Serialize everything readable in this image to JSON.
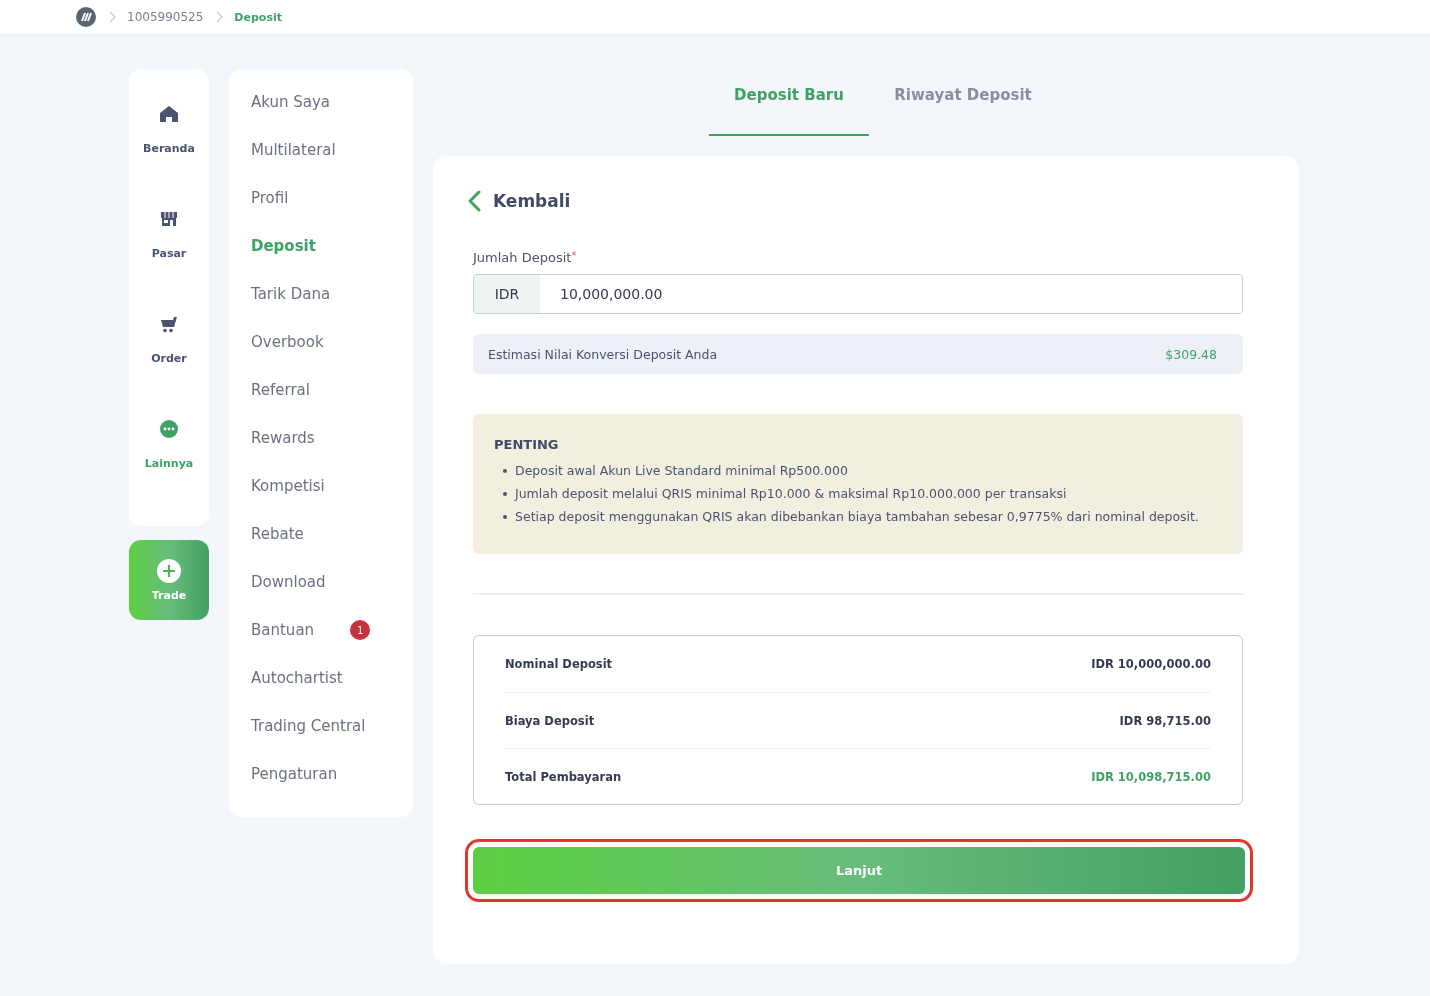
{
  "breadcrumb": [
    {
      "label": "1005990525",
      "selected": false
    },
    {
      "label": "Deposit",
      "selected": true
    }
  ],
  "rail": [
    {
      "label": "Beranda",
      "kind": "home",
      "selected": false
    },
    {
      "label": "Pasar",
      "kind": "market",
      "selected": false
    },
    {
      "label": "Order",
      "kind": "order",
      "selected": false
    },
    {
      "label": "Lainnya",
      "kind": "more",
      "selected": true
    }
  ],
  "trade_button": {
    "label": "Trade"
  },
  "menu": [
    {
      "label": "Akun Saya",
      "selected": false
    },
    {
      "label": "Multilateral",
      "selected": false
    },
    {
      "label": "Profil",
      "selected": false
    },
    {
      "label": "Deposit",
      "selected": true
    },
    {
      "label": "Tarik Dana",
      "selected": false
    },
    {
      "label": "Overbook",
      "selected": false
    },
    {
      "label": "Referral",
      "selected": false
    },
    {
      "label": "Rewards",
      "selected": false
    },
    {
      "label": "Kompetisi",
      "selected": false
    },
    {
      "label": "Rebate",
      "selected": false
    },
    {
      "label": "Download",
      "selected": false
    },
    {
      "label": "Bantuan",
      "selected": false,
      "badge": "1"
    },
    {
      "label": "Autochartist",
      "selected": false
    },
    {
      "label": "Trading Central",
      "selected": false
    },
    {
      "label": "Pengaturan",
      "selected": false
    }
  ],
  "tabs": [
    {
      "label": "Deposit Baru",
      "selected": true
    },
    {
      "label": "Riwayat Deposit",
      "selected": false
    }
  ],
  "back_link": {
    "label": "Kembali"
  },
  "amount_field": {
    "label": "Jumlah Deposit",
    "required_mark": "*",
    "currency": "IDR",
    "value": "10,000,000.00"
  },
  "estimate": {
    "label": "Estimasi Nilai Konversi Deposit Anda",
    "value": "$309.48"
  },
  "notice": {
    "title": "PENTING",
    "items": [
      "Deposit awal Akun Live Standard minimal Rp500.000",
      "Jumlah deposit melalui QRIS minimal Rp10.000 & maksimal Rp10.000.000 per transaksi",
      "Setiap deposit menggunakan QRIS akan dibebankan biaya tambahan sebesar 0,9775% dari nominal deposit."
    ]
  },
  "summary": [
    {
      "label": "Nominal Deposit",
      "value": "IDR 10,000,000.00",
      "kind": "normal"
    },
    {
      "label": "Biaya Deposit",
      "value": "IDR 98,715.00",
      "kind": "normal"
    },
    {
      "label": "Total Pembayaran",
      "value": "IDR 10,098,715.00",
      "kind": "total"
    }
  ],
  "submit_button": {
    "label": "Lanjut",
    "highlighted": true
  }
}
